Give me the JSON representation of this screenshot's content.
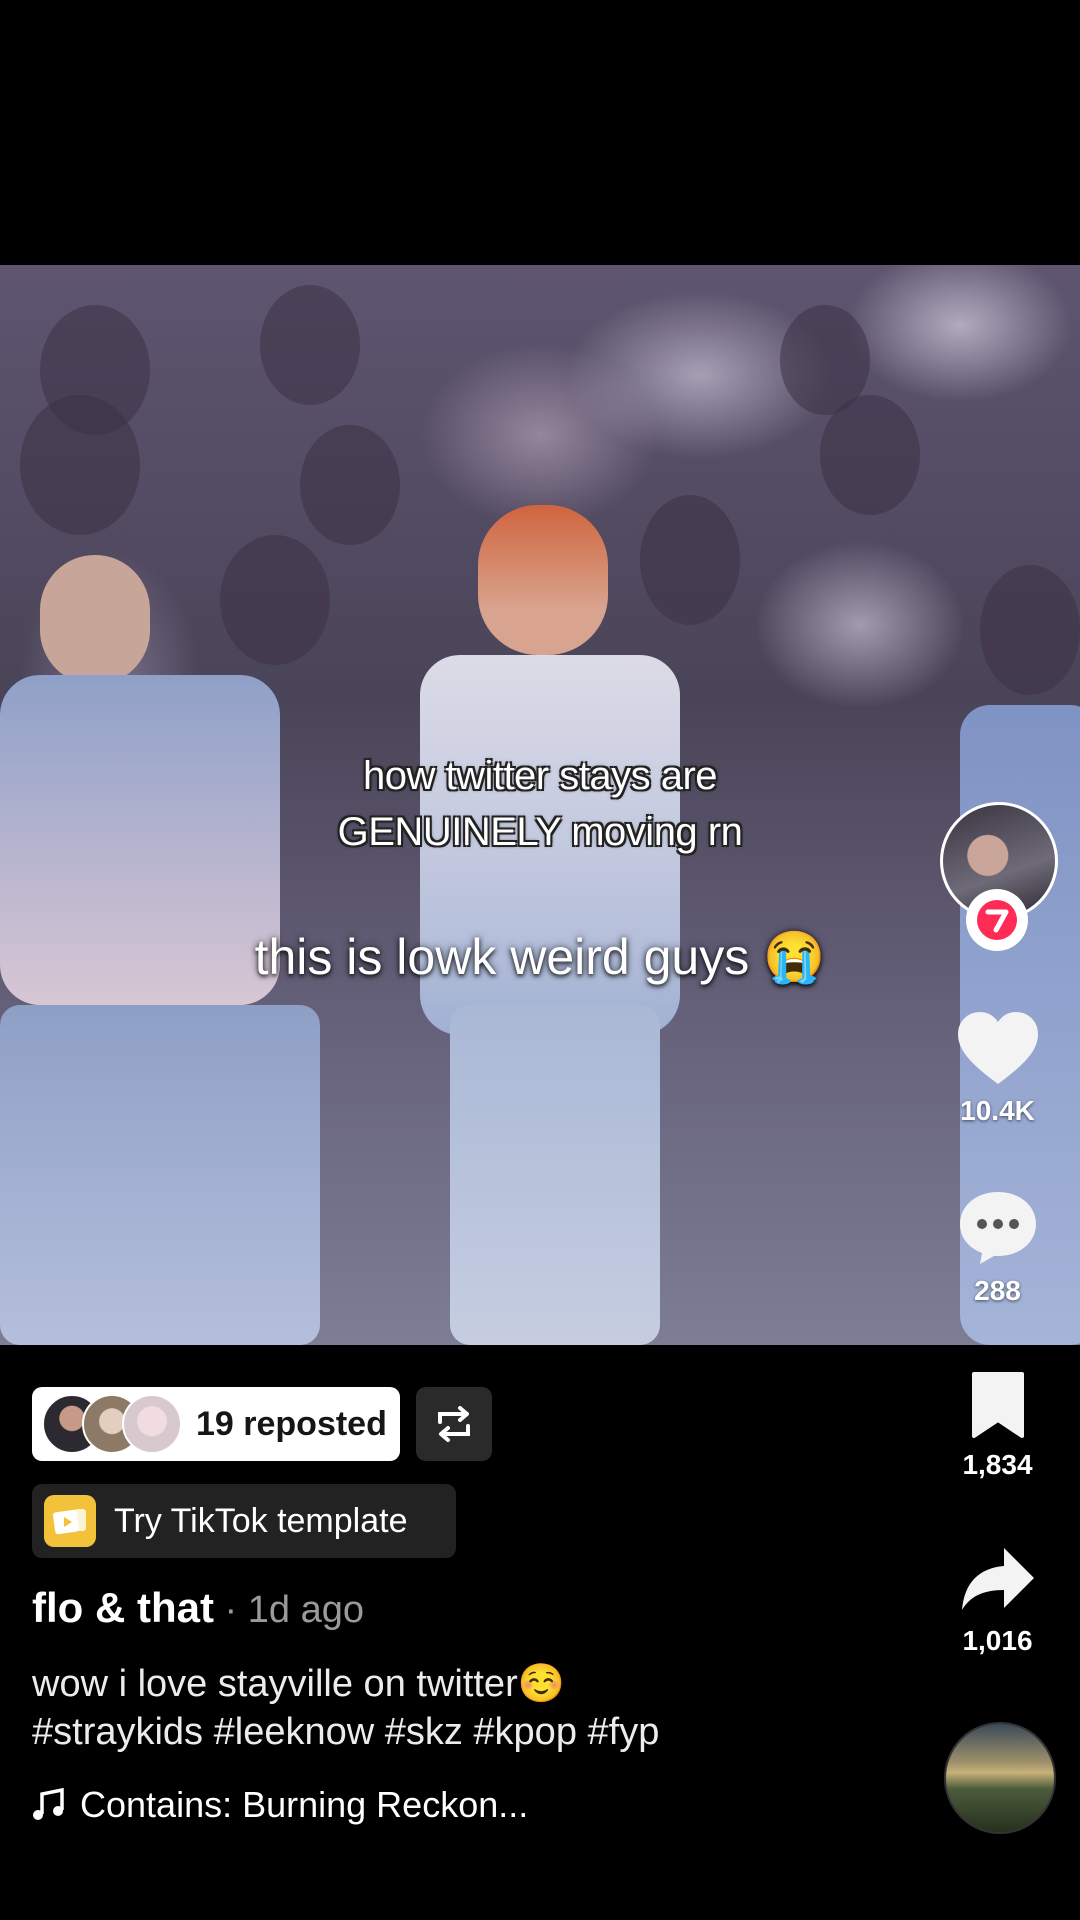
{
  "video": {
    "caption_top_line1": "how twitter stays are",
    "caption_top_line2": "GENUINELY moving rn",
    "caption_mid": "this is lowk weird guys 😭"
  },
  "rail": {
    "likes": "10.4K",
    "comments": "288",
    "saves": "1,834",
    "shares": "1,016"
  },
  "repost": {
    "label": "19 reposted"
  },
  "template": {
    "label": "Try TikTok template"
  },
  "post": {
    "author": "flo & that",
    "time": " · 1d ago",
    "description_line1": "wow i love stayville on twitter☺️",
    "description_line2": "#straykids #leeknow #skz #kpop #fyp",
    "music": "Contains: Burning Reckon..."
  },
  "colors": {
    "accent": "#fe2c55",
    "template_icon": "#f2c33a"
  }
}
